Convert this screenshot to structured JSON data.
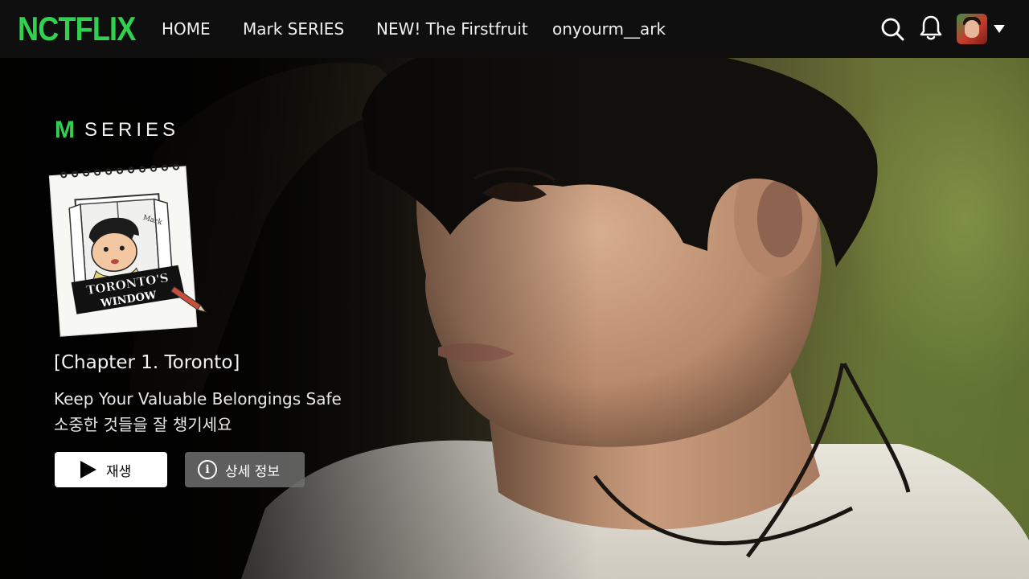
{
  "brand": {
    "logo_text": "NCTFLIX",
    "accent": "#2fd14e"
  },
  "nav": {
    "items": [
      {
        "label": "HOME"
      },
      {
        "label": "Mark SERIES"
      },
      {
        "label": "NEW! The Firstfruit"
      },
      {
        "label": "onyourm__ark"
      }
    ],
    "icons": [
      "search-icon",
      "bell-icon",
      "profile-avatar",
      "caret-down-icon"
    ]
  },
  "hero": {
    "series_letter": "M",
    "series_text": "SERIES",
    "poster": {
      "signature": "Mark",
      "sign_line1": "TORONTO'S",
      "sign_line2": "WINDOW"
    },
    "chapter": "[Chapter 1. Toronto]",
    "description_en": "Keep Your Valuable Belongings Safe",
    "description_ko": "소중한 것들을 잘 챙기세요",
    "play_label": "재생",
    "info_label": "상세 정보",
    "info_glyph": "i"
  }
}
